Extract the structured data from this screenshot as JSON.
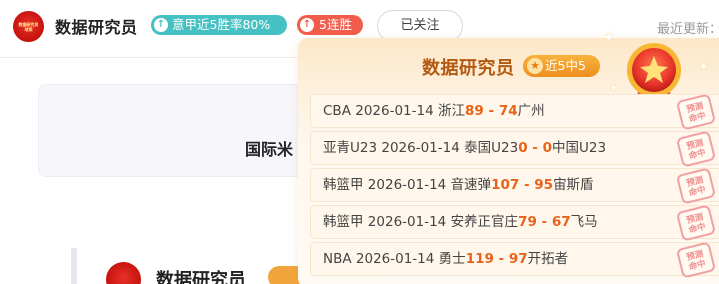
{
  "header": {
    "avatar_text": "数据研究员\n球探",
    "author_name": "数据研究员",
    "streak_badge": "意甲近5胜率80%",
    "win_badge": "5连胜",
    "follow_button": "已关注",
    "recent_update": "最近更新："
  },
  "background": {
    "card_text": "国际米",
    "author_name": "数据研究员"
  },
  "popup": {
    "title": "数据研究员",
    "badge": "近5中5",
    "stamp_text": "预测\n命中",
    "matches": [
      {
        "league": "CBA",
        "date": "2026-01-14",
        "home": "浙江",
        "home_score": "89",
        "away_score": "74",
        "away": "广州"
      },
      {
        "league": "亚青U23",
        "date": "2026-01-14",
        "home": "泰国U23",
        "home_score": "0",
        "away_score": "0",
        "away": "中国U23"
      },
      {
        "league": "韩篮甲",
        "date": "2026-01-14",
        "home": "音速弹",
        "home_score": "107",
        "away_score": "95",
        "away": "宙斯盾"
      },
      {
        "league": "韩篮甲",
        "date": "2026-01-14",
        "home": "安养正官庄",
        "home_score": "79",
        "away_score": "67",
        "away": "飞马"
      },
      {
        "league": "NBA",
        "date": "2026-01-14",
        "home": "勇士",
        "home_score": "119",
        "away_score": "97",
        "away": "开拓者"
      }
    ]
  },
  "colors": {
    "accent_teal": "#45c1c4",
    "accent_red": "#f25c4a",
    "score_orange": "#e8631a",
    "title_brown": "#b45a10"
  }
}
